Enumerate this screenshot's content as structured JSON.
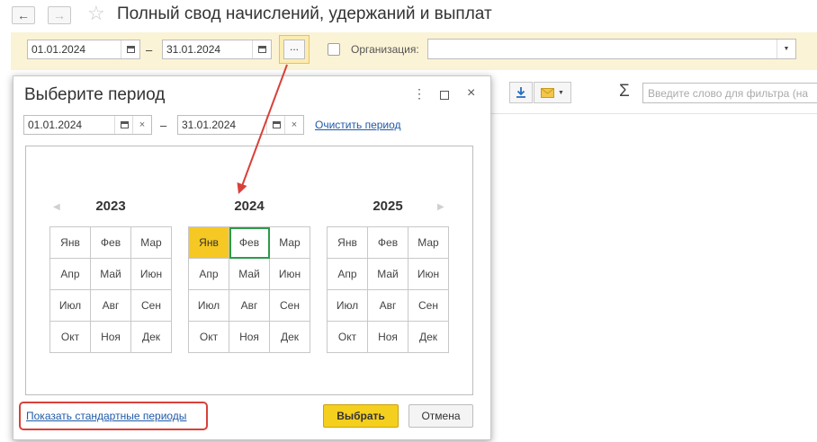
{
  "header": {
    "title": "Полный свод начислений, удержаний и выплат",
    "back_icon": "arrow-left-icon",
    "forward_icon": "arrow-right-icon",
    "favorite_icon": "star-icon"
  },
  "filter": {
    "date_from": "01.01.2024",
    "date_to": "31.01.2024",
    "separator": "–",
    "period_button": "...",
    "organization_label": "Организация:",
    "organization_value": ""
  },
  "toolbar": {
    "search_placeholder": "Введите слово для фильтра (на"
  },
  "dialog": {
    "title": "Выберите период",
    "date_from": "01.01.2024",
    "date_to": "31.01.2024",
    "separator": "–",
    "clear_label": "Очистить период",
    "years": [
      {
        "year": "2023",
        "months": [
          "Янв",
          "Фев",
          "Мар",
          "Апр",
          "Май",
          "Июн",
          "Июл",
          "Авг",
          "Сен",
          "Окт",
          "Ноя",
          "Дек"
        ]
      },
      {
        "year": "2024",
        "months": [
          "Янв",
          "Фев",
          "Мар",
          "Апр",
          "Май",
          "Июн",
          "Июл",
          "Авг",
          "Сен",
          "Окт",
          "Ноя",
          "Дек"
        ]
      },
      {
        "year": "2025",
        "months": [
          "Янв",
          "Фев",
          "Мар",
          "Апр",
          "Май",
          "Июн",
          "Июл",
          "Авг",
          "Сен",
          "Окт",
          "Ноя",
          "Дек"
        ]
      }
    ],
    "selected_month": "Янв 2024",
    "focused_month": "Фев 2024",
    "show_standard_label": "Показать стандартные периоды",
    "select_label": "Выбрать",
    "cancel_label": "Отмена"
  },
  "colors": {
    "selected_month": "#f5c823",
    "focused_month_border": "#2e9a4a",
    "annotation": "#d9403a",
    "link": "#1f5aa8",
    "filter_bar": "#fbf3d5"
  }
}
